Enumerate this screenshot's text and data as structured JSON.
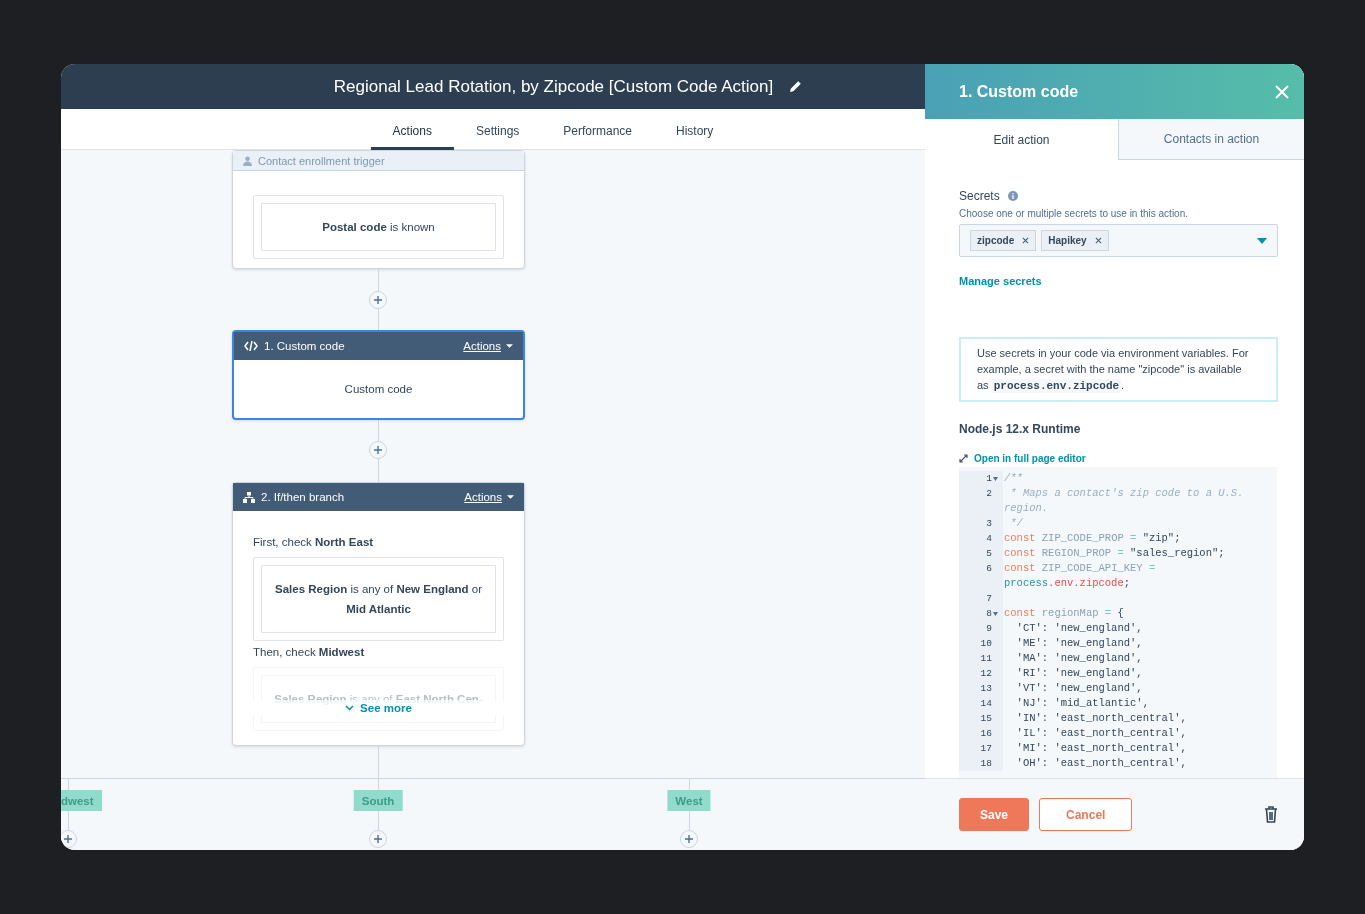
{
  "window": {
    "title": "Regional Lead Rotation, by Zipcode [Custom Code Action]"
  },
  "tabs": [
    {
      "label": "Actions",
      "selected": true
    },
    {
      "label": "Settings",
      "selected": false
    },
    {
      "label": "Performance",
      "selected": false
    },
    {
      "label": "History",
      "selected": false
    }
  ],
  "workflow": {
    "trigger": {
      "title": "Contact enrollment trigger",
      "condition": "**Postal code** is known"
    },
    "actions": [
      {
        "kind": "code",
        "title": "1. Custom code",
        "menu": "Actions",
        "selected": true,
        "body": "Custom code"
      },
      {
        "kind": "branch",
        "title": "2. If/then branch",
        "menu": "Actions",
        "selected": false,
        "checks": [
          {
            "heading": "First, check **North East**",
            "condition": "**Sales Region** is any of **New England** or **Mid Atlantic**",
            "faded": false
          },
          {
            "heading": "Then, check **Midwest**",
            "condition": "**Sales Region** is any of **East North Cen-**",
            "faded": true
          }
        ],
        "see_more": "See more"
      }
    ],
    "branches": [
      {
        "label": "dwest"
      },
      {
        "label": "South"
      },
      {
        "label": "West"
      }
    ]
  },
  "panel": {
    "title": "1. Custom code",
    "tabs": [
      {
        "label": "Edit action",
        "selected": true
      },
      {
        "label": "Contacts in action",
        "selected": false
      }
    ],
    "secrets": {
      "label": "Secrets",
      "help": "Choose one or multiple secrets to use in this action.",
      "tags": [
        "zipcode",
        "Hapikey"
      ]
    },
    "manage_link": "Manage secrets",
    "note": [
      {
        "kind": "text",
        "text": "Use secrets in your code via environment variables. For example, a secret with the name \"zipcode\" is available as "
      },
      {
        "kind": "code",
        "text": "process.env.zipcode"
      },
      {
        "kind": "text",
        "text": "."
      }
    ],
    "runtime": "Node.js 12.x Runtime",
    "editor_link": "Open in full page editor",
    "code": [
      {
        "num": "1",
        "foldable": true,
        "tokens": [
          {
            "kind": "comment",
            "text": "/**"
          }
        ]
      },
      {
        "num": "2",
        "tokens": [
          {
            "kind": "comment",
            "text": " * Maps a contact's zip code to a U.S. region."
          }
        ]
      },
      {
        "num": "3",
        "tokens": [
          {
            "kind": "comment",
            "text": " */"
          }
        ]
      },
      {
        "num": "4",
        "tokens": [
          {
            "kind": "keyword",
            "text": "const"
          },
          {
            "kind": "name",
            "text": " ZIP_CODE_PROP "
          },
          {
            "kind": "operator",
            "text": "="
          },
          {
            "kind": "string",
            "text": " \"zip\";"
          }
        ]
      },
      {
        "num": "5",
        "tokens": [
          {
            "kind": "keyword",
            "text": "const"
          },
          {
            "kind": "name",
            "text": " REGION_PROP "
          },
          {
            "kind": "operator",
            "text": "="
          },
          {
            "kind": "string",
            "text": " \"sales_region\";"
          }
        ]
      },
      {
        "num": "6",
        "tokens": [
          {
            "kind": "keyword",
            "text": "const"
          },
          {
            "kind": "name",
            "text": " ZIP_CODE_API_KEY "
          },
          {
            "kind": "operator",
            "text": "= "
          },
          {
            "kind": "object",
            "text": "process"
          },
          {
            "kind": "property",
            "text": ".env.zipcode"
          },
          {
            "kind": "string",
            "text": ";"
          }
        ]
      },
      {
        "num": "7"
      },
      {
        "num": "8",
        "foldable": true,
        "tokens": [
          {
            "kind": "keyword",
            "text": "const"
          },
          {
            "kind": "name",
            "text": " regionMap "
          },
          {
            "kind": "operator",
            "text": "="
          },
          {
            "kind": "string",
            "text": " {"
          }
        ]
      },
      {
        "num": "9",
        "tokens": [
          {
            "kind": "string",
            "text": "  'CT': 'new_england',"
          }
        ]
      },
      {
        "num": "10",
        "tokens": [
          {
            "kind": "string",
            "text": "  'ME': 'new_england',"
          }
        ]
      },
      {
        "num": "11",
        "tokens": [
          {
            "kind": "string",
            "text": "  'MA': 'new_england',"
          }
        ]
      },
      {
        "num": "12",
        "tokens": [
          {
            "kind": "string",
            "text": "  'RI': 'new_england',"
          }
        ]
      },
      {
        "num": "13",
        "tokens": [
          {
            "kind": "string",
            "text": "  'VT': 'new_england',"
          }
        ]
      },
      {
        "num": "14",
        "tokens": [
          {
            "kind": "string",
            "text": "  'NJ': 'mid_atlantic',"
          }
        ]
      },
      {
        "num": "15",
        "tokens": [
          {
            "kind": "string",
            "text": "  'IN': 'east_north_central',"
          }
        ]
      },
      {
        "num": "16",
        "tokens": [
          {
            "kind": "string",
            "text": "  'IL': 'east_north_central',"
          }
        ]
      },
      {
        "num": "17",
        "tokens": [
          {
            "kind": "string",
            "text": "  'MI': 'east_north_central',"
          }
        ]
      },
      {
        "num": "18",
        "tokens": [
          {
            "kind": "string",
            "text": "  'OH': 'east_north_central',"
          }
        ]
      }
    ],
    "buttons": [
      {
        "kind": "primary",
        "label": "Save"
      },
      {
        "kind": "secondary",
        "label": "Cancel"
      }
    ]
  }
}
